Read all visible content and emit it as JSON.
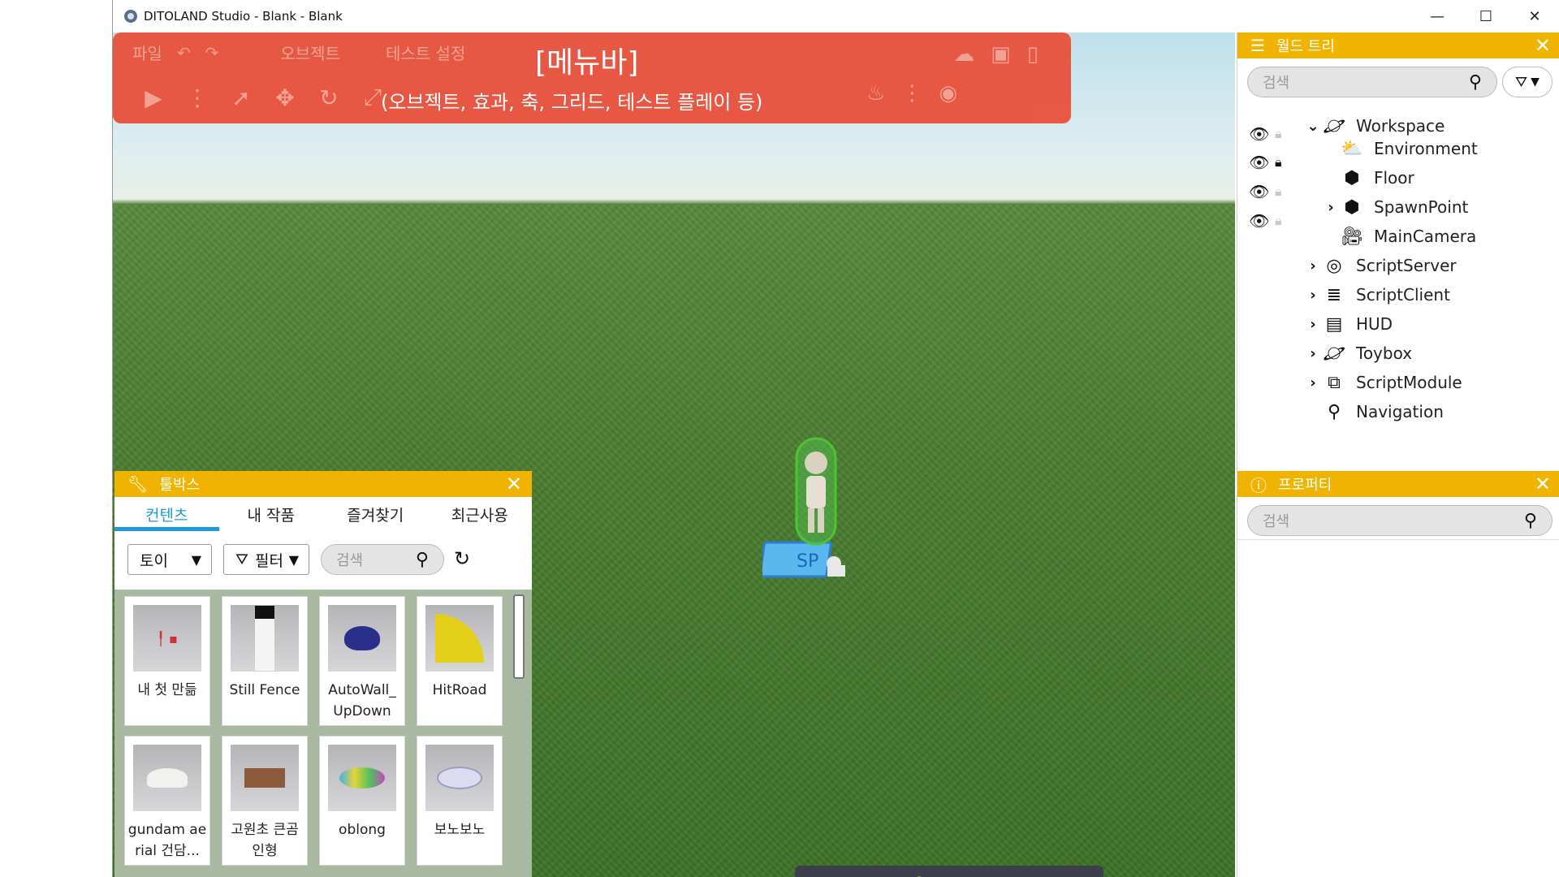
{
  "window": {
    "title": "DITOLAND Studio - Blank - Blank",
    "controls": {
      "minimize": "—",
      "maximize": "☐",
      "close": "✕"
    }
  },
  "menubar": {
    "overlay_title": "[메뉴바]",
    "overlay_subtitle": "(오브젝트, 효과, 축, 그리드, 테스트 플레이 등)",
    "items": [
      "파일",
      "오브젝트",
      "테스트 설정"
    ]
  },
  "world_tree": {
    "title": "월드 트리",
    "search_placeholder": "검색",
    "items": [
      {
        "label": "Workspace",
        "icon": "planet-icon",
        "expanded": true
      },
      {
        "label": "Environment",
        "icon": "weather-icon",
        "eye": true,
        "lock": "unlocked"
      },
      {
        "label": "Floor",
        "icon": "cube-icon",
        "eye": true,
        "lock": "locked"
      },
      {
        "label": "SpawnPoint",
        "icon": "cube-icon",
        "eye": true,
        "lock": "unlocked",
        "collapsed": true
      },
      {
        "label": "MainCamera",
        "icon": "camera-icon",
        "eye": true,
        "lock": "unlocked"
      },
      {
        "label": "ScriptServer",
        "icon": "server-icon",
        "collapsed": true
      },
      {
        "label": "ScriptClient",
        "icon": "client-icon",
        "collapsed": true
      },
      {
        "label": "HUD",
        "icon": "hud-icon",
        "collapsed": true
      },
      {
        "label": "Toybox",
        "icon": "toybox-icon",
        "collapsed": true
      },
      {
        "label": "ScriptModule",
        "icon": "module-icon",
        "collapsed": true
      },
      {
        "label": "Navigation",
        "icon": "location-pin-icon"
      }
    ]
  },
  "properties": {
    "title": "프로퍼티",
    "search_placeholder": "검색"
  },
  "toolbox": {
    "title": "툴박스",
    "tabs": [
      "컨텐츠",
      "내 작품",
      "즐겨찾기",
      "최근사용"
    ],
    "active_tab": "컨텐츠",
    "category_select": "토이",
    "filter_select": "필터",
    "search_placeholder": "검색",
    "items": [
      {
        "label": "내 첫 만듦",
        "label2": ""
      },
      {
        "label": "Still Fence",
        "label2": ""
      },
      {
        "label": "AutoWall_",
        "label2": "UpDown"
      },
      {
        "label": "HitRoad",
        "label2": ""
      },
      {
        "label": "gundam ae",
        "label2": "rial 건담..."
      },
      {
        "label": "고원초 큰곰",
        "label2": "인형"
      },
      {
        "label": "oblong",
        "label2": ""
      },
      {
        "label": "보노보노",
        "label2": ""
      }
    ]
  },
  "bottom_toolbar": {
    "icons": [
      "list-icon",
      "info-icon",
      "wrench-icon",
      "palette-icon",
      "edit-icon",
      "document-icon"
    ]
  },
  "colors": {
    "menubar": "#e8533f",
    "panel_header": "#f0b400",
    "active_tab": "#1c9bd8",
    "bottom_bar": "#3e3f4c"
  }
}
